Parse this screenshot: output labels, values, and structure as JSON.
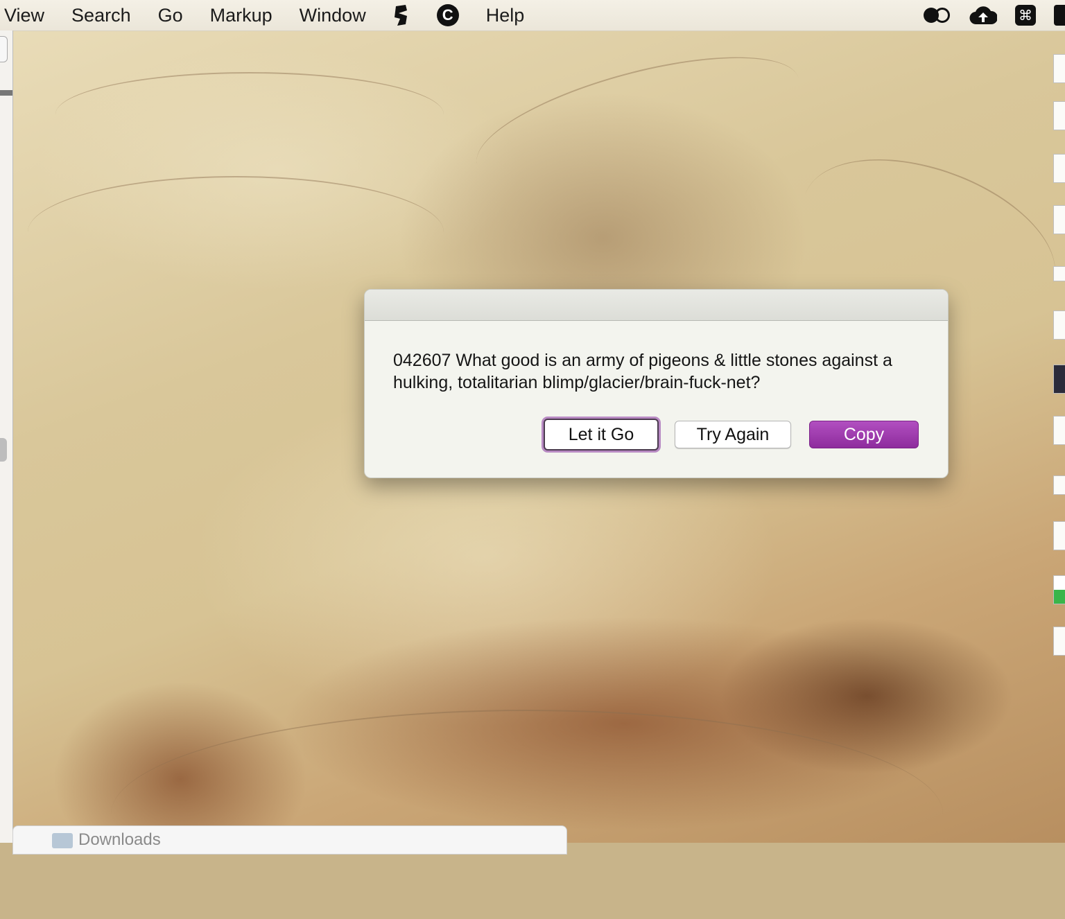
{
  "menubar": {
    "items": [
      "View",
      "Search",
      "Go",
      "Markup",
      "Window"
    ],
    "help": "Help",
    "c_glyph": "C"
  },
  "status_icons": {
    "cmd_glyph": "⌘"
  },
  "dialog": {
    "message": "042607  What good is an army of pigeons & little stones against a hulking, totalitarian blimp/glacier/brain-fuck-net?",
    "buttons": {
      "let_it_go": "Let it Go",
      "try_again": "Try Again",
      "copy": "Copy"
    },
    "default_button_color": "#9b3aab"
  },
  "finder_window": {
    "title": "Downloads"
  }
}
